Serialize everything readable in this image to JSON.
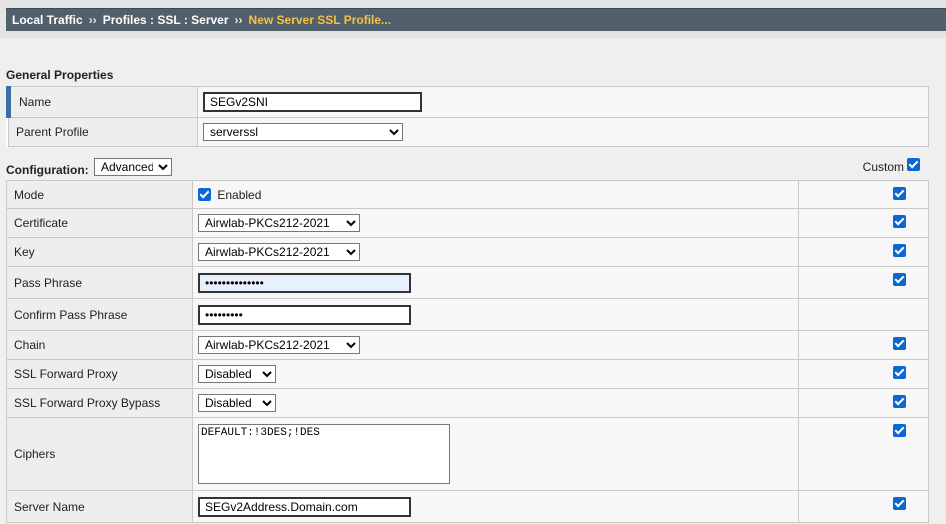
{
  "breadcrumb": {
    "items": [
      "Local Traffic",
      "Profiles : SSL : Server"
    ],
    "separator": "››",
    "current": "New Server SSL Profile..."
  },
  "general": {
    "title": "General Properties",
    "name_label": "Name",
    "name_value": "SEGv2SNI",
    "parent_label": "Parent Profile",
    "parent_value": "serverssl"
  },
  "configuration": {
    "label": "Configuration:",
    "mode_select": "Advanced",
    "custom_label": "Custom",
    "rows": {
      "mode": {
        "label": "Mode",
        "value": "Enabled"
      },
      "certificate": {
        "label": "Certificate",
        "value": "Airwlab-PKCs212-2021"
      },
      "key": {
        "label": "Key",
        "value": "Airwlab-PKCs212-2021"
      },
      "pass_phrase": {
        "label": "Pass Phrase",
        "value": "••••••••••••••"
      },
      "confirm_pass_phrase": {
        "label": "Confirm Pass Phrase",
        "value": "•••••••••"
      },
      "chain": {
        "label": "Chain",
        "value": "Airwlab-PKCs212-2021"
      },
      "ssl_forward_proxy": {
        "label": "SSL Forward Proxy",
        "value": "Disabled"
      },
      "ssl_forward_proxy_bypass": {
        "label": "SSL Forward Proxy Bypass",
        "value": "Disabled"
      },
      "ciphers": {
        "label": "Ciphers",
        "value": "DEFAULT:!3DES;!DES"
      },
      "server_name": {
        "label": "Server Name",
        "value": "SEGv2Address.Domain.com"
      }
    }
  },
  "colors": {
    "breadcrumb_bg": "#52606b",
    "breadcrumb_current": "#f6c244",
    "checkbox": "#0b66d6",
    "selected_marker": "#3b6ea5"
  }
}
